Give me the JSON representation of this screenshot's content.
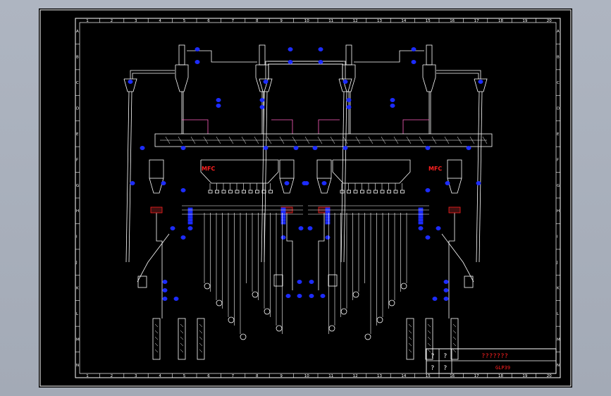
{
  "drawing": {
    "column_numbers": [
      "1",
      "2",
      "3",
      "4",
      "5",
      "6",
      "7",
      "8",
      "9",
      "10",
      "11",
      "12",
      "13",
      "14",
      "15",
      "16",
      "17",
      "18",
      "19",
      "20"
    ],
    "row_letters": [
      "A",
      "B",
      "C",
      "D",
      "E",
      "F",
      "G",
      "H",
      "I",
      "J",
      "K",
      "L",
      "M",
      "N"
    ],
    "controller_labels": [
      "MFC",
      "MFC"
    ],
    "title_block": {
      "cell_a": "?",
      "cell_b": "?",
      "cell_c": "?",
      "cell_d": "?",
      "title": "???????",
      "drawing_no": "GLP39"
    }
  },
  "colors": {
    "background": "#000000",
    "lines": "#ffffff",
    "instruments": "#1d2cff",
    "labels_red": "#ff2020",
    "pink": "#ff60c0"
  }
}
